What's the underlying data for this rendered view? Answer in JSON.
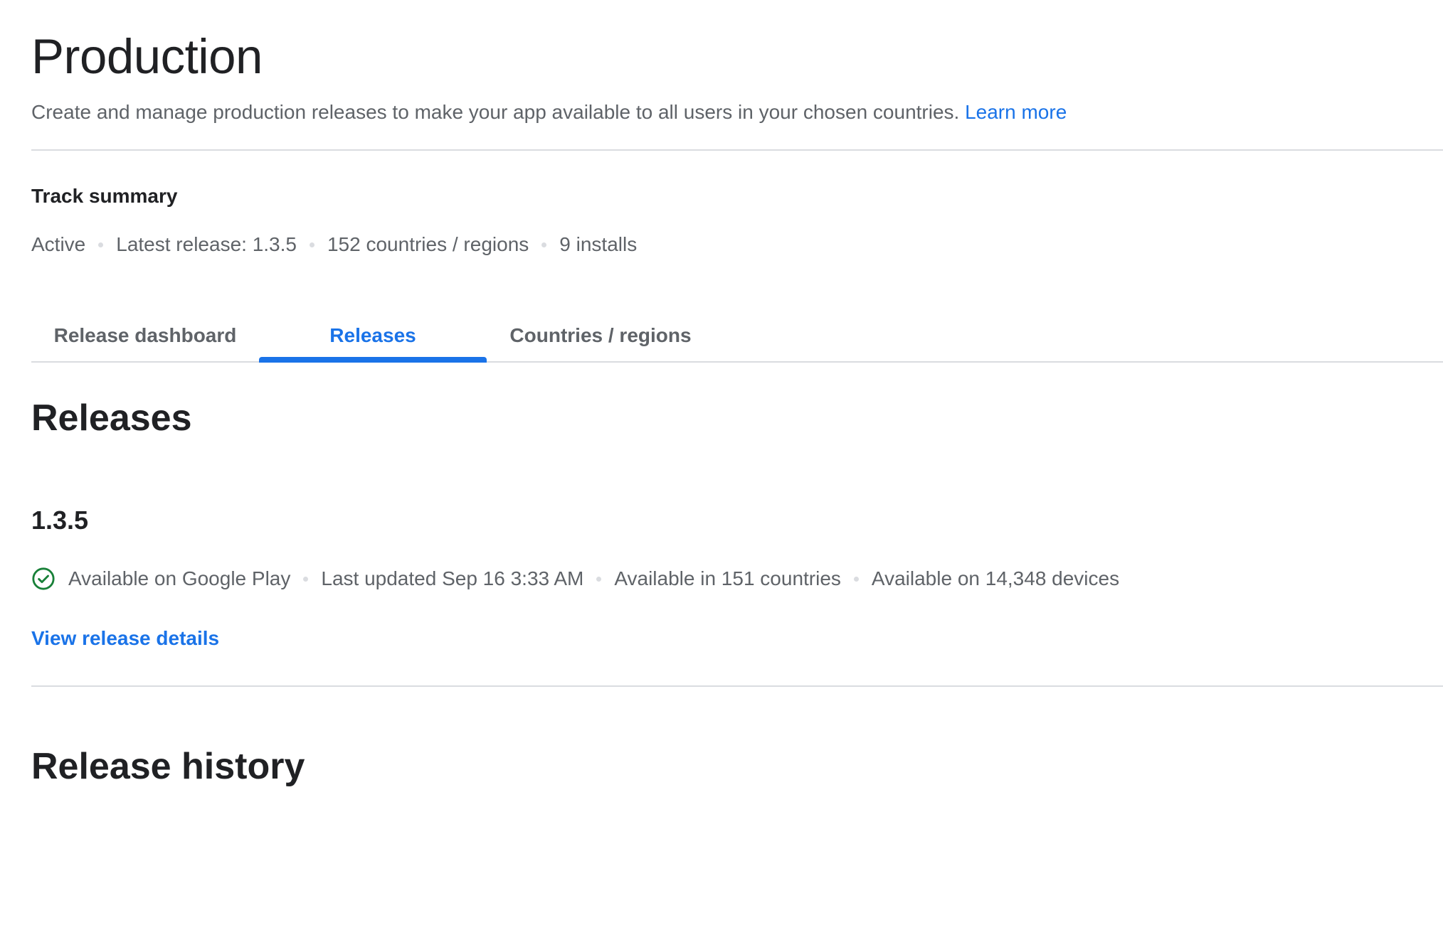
{
  "header": {
    "title": "Production",
    "description": "Create and manage production releases to make your app available to all users in your chosen countries.",
    "learn_more_label": "Learn more"
  },
  "track_summary": {
    "heading": "Track summary",
    "status": "Active",
    "latest_release": "Latest release: 1.3.5",
    "countries": "152 countries / regions",
    "installs": "9 installs"
  },
  "tabs": [
    {
      "label": "Release dashboard",
      "active": false
    },
    {
      "label": "Releases",
      "active": true
    },
    {
      "label": "Countries / regions",
      "active": false
    }
  ],
  "releases": {
    "heading": "Releases",
    "items": [
      {
        "version": "1.3.5",
        "status_icon": "check-circle-icon",
        "status": "Available on Google Play",
        "last_updated": "Last updated Sep 16 3:33 AM",
        "countries": "Available in 151 countries",
        "devices": "Available on 14,348 devices",
        "details_link": "View release details"
      }
    ]
  },
  "release_history": {
    "heading": "Release history"
  },
  "colors": {
    "accent": "#1a73e8",
    "success": "#188038",
    "divider": "#dadce0",
    "text_primary": "#202124",
    "text_secondary": "#5f6368"
  }
}
